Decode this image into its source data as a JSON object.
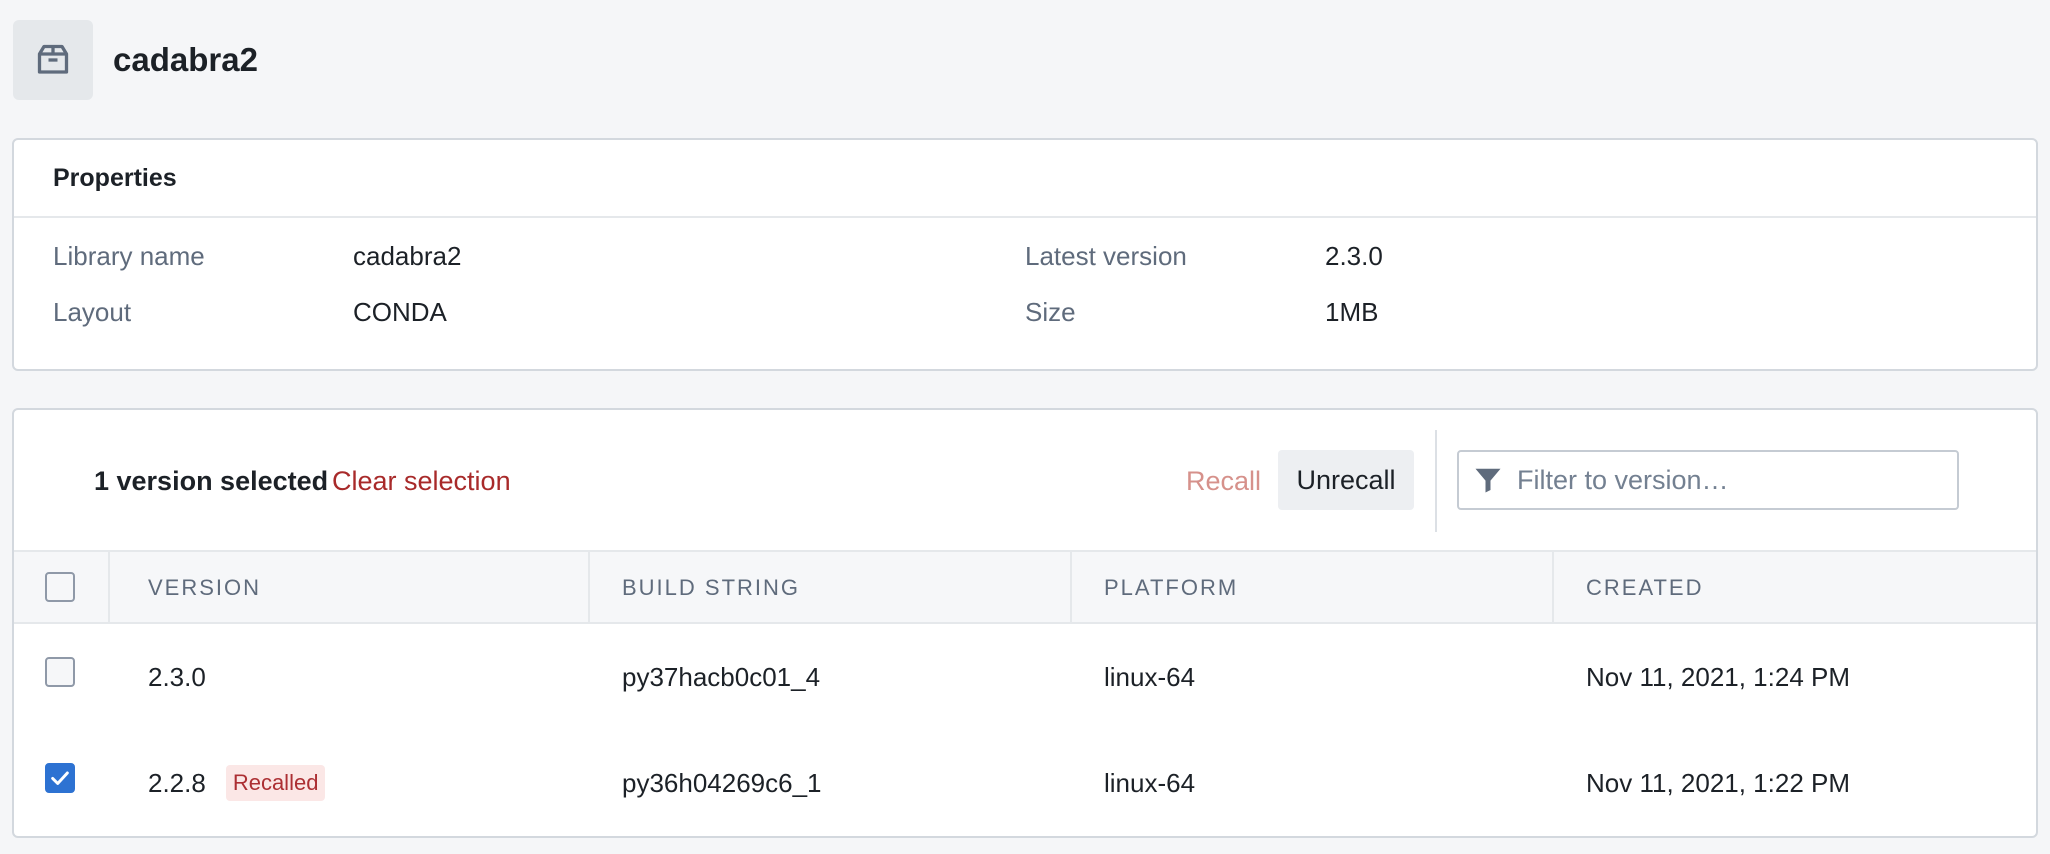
{
  "library": {
    "title": "cadabra2",
    "icon": "box-icon"
  },
  "properties": {
    "heading": "Properties",
    "rows": [
      {
        "label": "Library name",
        "value": "cadabra2"
      },
      {
        "label": "Layout",
        "value": "CONDA"
      },
      {
        "label": "Latest version",
        "value": "2.3.0"
      },
      {
        "label": "Size",
        "value": "1MB"
      }
    ]
  },
  "toolbar": {
    "selection_text": "1 version selected",
    "clear_label": "Clear selection",
    "recall_label": "Recall",
    "unrecall_label": "Unrecall",
    "filter_placeholder": "Filter to version…",
    "filter_value": ""
  },
  "table": {
    "columns": [
      "VERSION",
      "BUILD STRING",
      "PLATFORM",
      "CREATED"
    ],
    "rows": [
      {
        "selected": false,
        "version": "2.3.0",
        "tag": "",
        "build": "py37hacb0c01_4",
        "platform": "linux-64",
        "created": "Nov 11, 2021, 1:24 PM"
      },
      {
        "selected": true,
        "version": "2.2.8",
        "tag": "Recalled",
        "build": "py36h04269c6_1",
        "platform": "linux-64",
        "created": "Nov 11, 2021, 1:22 PM"
      }
    ]
  },
  "colors": {
    "accent": "#2d72d2",
    "danger": "#a82a2a",
    "tag_bg": "#fbe7e6"
  }
}
